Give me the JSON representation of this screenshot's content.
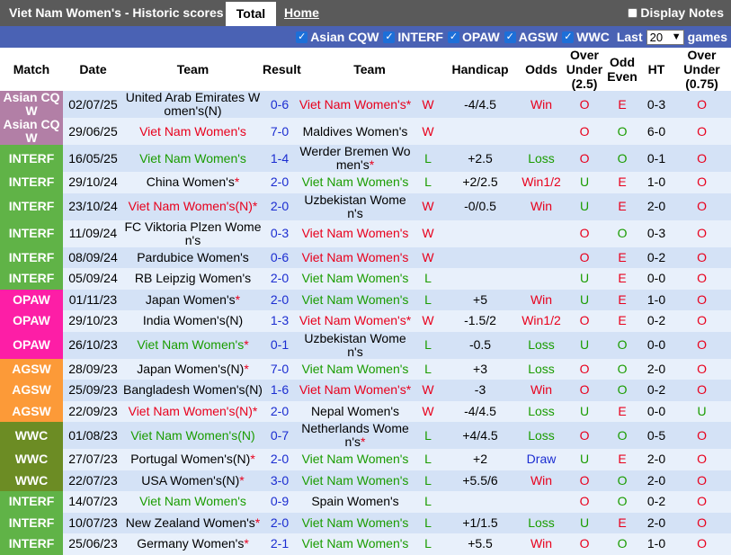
{
  "header": {
    "title": "Viet Nam Women's - Historic scores",
    "tab_total": "Total",
    "tab_home": "Home",
    "display_notes": "Display Notes"
  },
  "filters": {
    "items": [
      "Asian CQW",
      "INTERF",
      "OPAW",
      "AGSW",
      "WWC"
    ],
    "last_label": "Last",
    "count": "20",
    "games_label": "games"
  },
  "columns": {
    "match": "Match",
    "date": "Date",
    "team1": "Team",
    "result": "Result",
    "team2": "Team",
    "handicap": "Handicap",
    "odds": "Odds",
    "ou": "Over Under (2.5)",
    "oe": "Odd Even",
    "ht": "HT",
    "ou2": "Over Under (0.75)"
  },
  "colors": {
    "Asian CQ W": "#b27fa6",
    "INTERF": "#60b347",
    "OPAW": "#fd1ea6",
    "AGSW": "#fc9a38",
    "WWC": "#6c8c24",
    "home": "#e8001c",
    "win_team": "#e8001c",
    "draw_team": "#1a9c00"
  },
  "rows": [
    {
      "match": "Asian CQ W",
      "date": "02/07/25",
      "home": "United Arab Emirates Women's(N)",
      "hs": "",
      "hc": "",
      "result": "0-6",
      "away": "Viet Nam Women's",
      "as": "*",
      "ac": "red",
      "wl": "W",
      "wlc": "red",
      "hcap": "-4/4.5",
      "odds": "Win",
      "oc": "red",
      "ou": "O",
      "ouc": "red",
      "oe": "E",
      "oec": "red",
      "ht": "0-3",
      "ou2": "O",
      "ou2c": "red"
    },
    {
      "match": "Asian CQ W",
      "date": "29/06/25",
      "home": "Viet Nam Women's",
      "hs": "",
      "hc": "red",
      "result": "7-0",
      "away": "Maldives Women's",
      "as": "",
      "ac": "",
      "wl": "W",
      "wlc": "red",
      "hcap": "",
      "odds": "",
      "oc": "",
      "ou": "O",
      "ouc": "red",
      "oe": "O",
      "oec": "green",
      "ht": "6-0",
      "ou2": "O",
      "ou2c": "red"
    },
    {
      "match": "INTERF",
      "date": "16/05/25",
      "home": "Viet Nam Women's",
      "hs": "",
      "hc": "green",
      "result": "1-4",
      "away": "Werder Bremen Women's",
      "as": "*",
      "ac": "",
      "wl": "L",
      "wlc": "green",
      "hcap": "+2.5",
      "odds": "Loss",
      "oc": "green",
      "ou": "O",
      "ouc": "red",
      "oe": "O",
      "oec": "green",
      "ht": "0-1",
      "ou2": "O",
      "ou2c": "red"
    },
    {
      "match": "INTERF",
      "date": "29/10/24",
      "home": "China Women's",
      "hs": "*",
      "hc": "",
      "result": "2-0",
      "away": "Viet Nam Women's",
      "as": "",
      "ac": "green",
      "wl": "L",
      "wlc": "green",
      "hcap": "+2/2.5",
      "odds": "Win1/2",
      "oc": "red",
      "ou": "U",
      "ouc": "green",
      "oe": "E",
      "oec": "red",
      "ht": "1-0",
      "ou2": "O",
      "ou2c": "red"
    },
    {
      "match": "INTERF",
      "date": "23/10/24",
      "home": "Viet Nam Women's(N)",
      "hs": "*",
      "hc": "red",
      "result": "2-0",
      "away": "Uzbekistan Women's",
      "as": "",
      "ac": "",
      "wl": "W",
      "wlc": "red",
      "hcap": "-0/0.5",
      "odds": "Win",
      "oc": "red",
      "ou": "U",
      "ouc": "green",
      "oe": "E",
      "oec": "red",
      "ht": "2-0",
      "ou2": "O",
      "ou2c": "red"
    },
    {
      "match": "INTERF",
      "date": "11/09/24",
      "home": "FC Viktoria Plzen Women's",
      "hs": "",
      "hc": "",
      "result": "0-3",
      "away": "Viet Nam Women's",
      "as": "",
      "ac": "red",
      "wl": "W",
      "wlc": "red",
      "hcap": "",
      "odds": "",
      "oc": "",
      "ou": "O",
      "ouc": "red",
      "oe": "O",
      "oec": "green",
      "ht": "0-3",
      "ou2": "O",
      "ou2c": "red"
    },
    {
      "match": "INTERF",
      "date": "08/09/24",
      "home": "Pardubice Women's",
      "hs": "",
      "hc": "",
      "result": "0-6",
      "away": "Viet Nam Women's",
      "as": "",
      "ac": "red",
      "wl": "W",
      "wlc": "red",
      "hcap": "",
      "odds": "",
      "oc": "",
      "ou": "O",
      "ouc": "red",
      "oe": "E",
      "oec": "red",
      "ht": "0-2",
      "ou2": "O",
      "ou2c": "red"
    },
    {
      "match": "INTERF",
      "date": "05/09/24",
      "home": "RB Leipzig Women's",
      "hs": "",
      "hc": "",
      "result": "2-0",
      "away": "Viet Nam Women's",
      "as": "",
      "ac": "green",
      "wl": "L",
      "wlc": "green",
      "hcap": "",
      "odds": "",
      "oc": "",
      "ou": "U",
      "ouc": "green",
      "oe": "E",
      "oec": "red",
      "ht": "0-0",
      "ou2": "O",
      "ou2c": "red"
    },
    {
      "match": "OPAW",
      "date": "01/11/23",
      "home": "Japan Women's",
      "hs": "*",
      "hc": "",
      "result": "2-0",
      "away": "Viet Nam Women's",
      "as": "",
      "ac": "green",
      "wl": "L",
      "wlc": "green",
      "hcap": "+5",
      "odds": "Win",
      "oc": "red",
      "ou": "U",
      "ouc": "green",
      "oe": "E",
      "oec": "red",
      "ht": "1-0",
      "ou2": "O",
      "ou2c": "red"
    },
    {
      "match": "OPAW",
      "date": "29/10/23",
      "home": "India Women's(N)",
      "hs": "",
      "hc": "",
      "result": "1-3",
      "away": "Viet Nam Women's",
      "as": "*",
      "ac": "red",
      "wl": "W",
      "wlc": "red",
      "hcap": "-1.5/2",
      "odds": "Win1/2",
      "oc": "red",
      "ou": "O",
      "ouc": "red",
      "oe": "E",
      "oec": "red",
      "ht": "0-2",
      "ou2": "O",
      "ou2c": "red"
    },
    {
      "match": "OPAW",
      "date": "26/10/23",
      "home": "Viet Nam Women's",
      "hs": "*",
      "hc": "green",
      "result": "0-1",
      "away": "Uzbekistan Women's",
      "as": "",
      "ac": "",
      "wl": "L",
      "wlc": "green",
      "hcap": "-0.5",
      "odds": "Loss",
      "oc": "green",
      "ou": "U",
      "ouc": "green",
      "oe": "O",
      "oec": "green",
      "ht": "0-0",
      "ou2": "O",
      "ou2c": "red"
    },
    {
      "match": "AGSW",
      "date": "28/09/23",
      "home": "Japan Women's(N)",
      "hs": "*",
      "hc": "",
      "result": "7-0",
      "away": "Viet Nam Women's",
      "as": "",
      "ac": "green",
      "wl": "L",
      "wlc": "green",
      "hcap": "+3",
      "odds": "Loss",
      "oc": "green",
      "ou": "O",
      "ouc": "red",
      "oe": "O",
      "oec": "green",
      "ht": "2-0",
      "ou2": "O",
      "ou2c": "red"
    },
    {
      "match": "AGSW",
      "date": "25/09/23",
      "home": "Bangladesh Women's(N)",
      "hs": "",
      "hc": "",
      "result": "1-6",
      "away": "Viet Nam Women's",
      "as": "*",
      "ac": "red",
      "wl": "W",
      "wlc": "red",
      "hcap": "-3",
      "odds": "Win",
      "oc": "red",
      "ou": "O",
      "ouc": "red",
      "oe": "O",
      "oec": "green",
      "ht": "0-2",
      "ou2": "O",
      "ou2c": "red"
    },
    {
      "match": "AGSW",
      "date": "22/09/23",
      "home": "Viet Nam Women's(N)",
      "hs": "*",
      "hc": "red",
      "result": "2-0",
      "away": "Nepal Women's",
      "as": "",
      "ac": "",
      "wl": "W",
      "wlc": "red",
      "hcap": "-4/4.5",
      "odds": "Loss",
      "oc": "green",
      "ou": "U",
      "ouc": "green",
      "oe": "E",
      "oec": "red",
      "ht": "0-0",
      "ou2": "U",
      "ou2c": "green"
    },
    {
      "match": "WWC",
      "date": "01/08/23",
      "home": "Viet Nam Women's(N)",
      "hs": "",
      "hc": "green",
      "result": "0-7",
      "away": "Netherlands Women's",
      "as": "*",
      "ac": "",
      "wl": "L",
      "wlc": "green",
      "hcap": "+4/4.5",
      "odds": "Loss",
      "oc": "green",
      "ou": "O",
      "ouc": "red",
      "oe": "O",
      "oec": "green",
      "ht": "0-5",
      "ou2": "O",
      "ou2c": "red"
    },
    {
      "match": "WWC",
      "date": "27/07/23",
      "home": "Portugal Women's(N)",
      "hs": "*",
      "hc": "",
      "result": "2-0",
      "away": "Viet Nam Women's",
      "as": "",
      "ac": "green",
      "wl": "L",
      "wlc": "green",
      "hcap": "+2",
      "odds": "Draw",
      "oc": "blue",
      "ou": "U",
      "ouc": "green",
      "oe": "E",
      "oec": "red",
      "ht": "2-0",
      "ou2": "O",
      "ou2c": "red"
    },
    {
      "match": "WWC",
      "date": "22/07/23",
      "home": "USA Women's(N)",
      "hs": "*",
      "hc": "",
      "result": "3-0",
      "away": "Viet Nam Women's",
      "as": "",
      "ac": "green",
      "wl": "L",
      "wlc": "green",
      "hcap": "+5.5/6",
      "odds": "Win",
      "oc": "red",
      "ou": "O",
      "ouc": "red",
      "oe": "O",
      "oec": "green",
      "ht": "2-0",
      "ou2": "O",
      "ou2c": "red"
    },
    {
      "match": "INTERF",
      "date": "14/07/23",
      "home": "Viet Nam Women's",
      "hs": "",
      "hc": "green",
      "result": "0-9",
      "away": "Spain Women's",
      "as": "",
      "ac": "",
      "wl": "L",
      "wlc": "green",
      "hcap": "",
      "odds": "",
      "oc": "",
      "ou": "O",
      "ouc": "red",
      "oe": "O",
      "oec": "green",
      "ht": "0-2",
      "ou2": "O",
      "ou2c": "red"
    },
    {
      "match": "INTERF",
      "date": "10/07/23",
      "home": "New Zealand Women's",
      "hs": "*",
      "hc": "",
      "result": "2-0",
      "away": "Viet Nam Women's",
      "as": "",
      "ac": "green",
      "wl": "L",
      "wlc": "green",
      "hcap": "+1/1.5",
      "odds": "Loss",
      "oc": "green",
      "ou": "U",
      "ouc": "green",
      "oe": "E",
      "oec": "red",
      "ht": "2-0",
      "ou2": "O",
      "ou2c": "red"
    },
    {
      "match": "INTERF",
      "date": "25/06/23",
      "home": "Germany Women's",
      "hs": "*",
      "hc": "",
      "result": "2-1",
      "away": "Viet Nam Women's",
      "as": "",
      "ac": "green",
      "wl": "L",
      "wlc": "green",
      "hcap": "+5.5",
      "odds": "Win",
      "oc": "red",
      "ou": "O",
      "ouc": "red",
      "oe": "O",
      "oec": "green",
      "ht": "1-0",
      "ou2": "O",
      "ou2c": "red"
    }
  ]
}
